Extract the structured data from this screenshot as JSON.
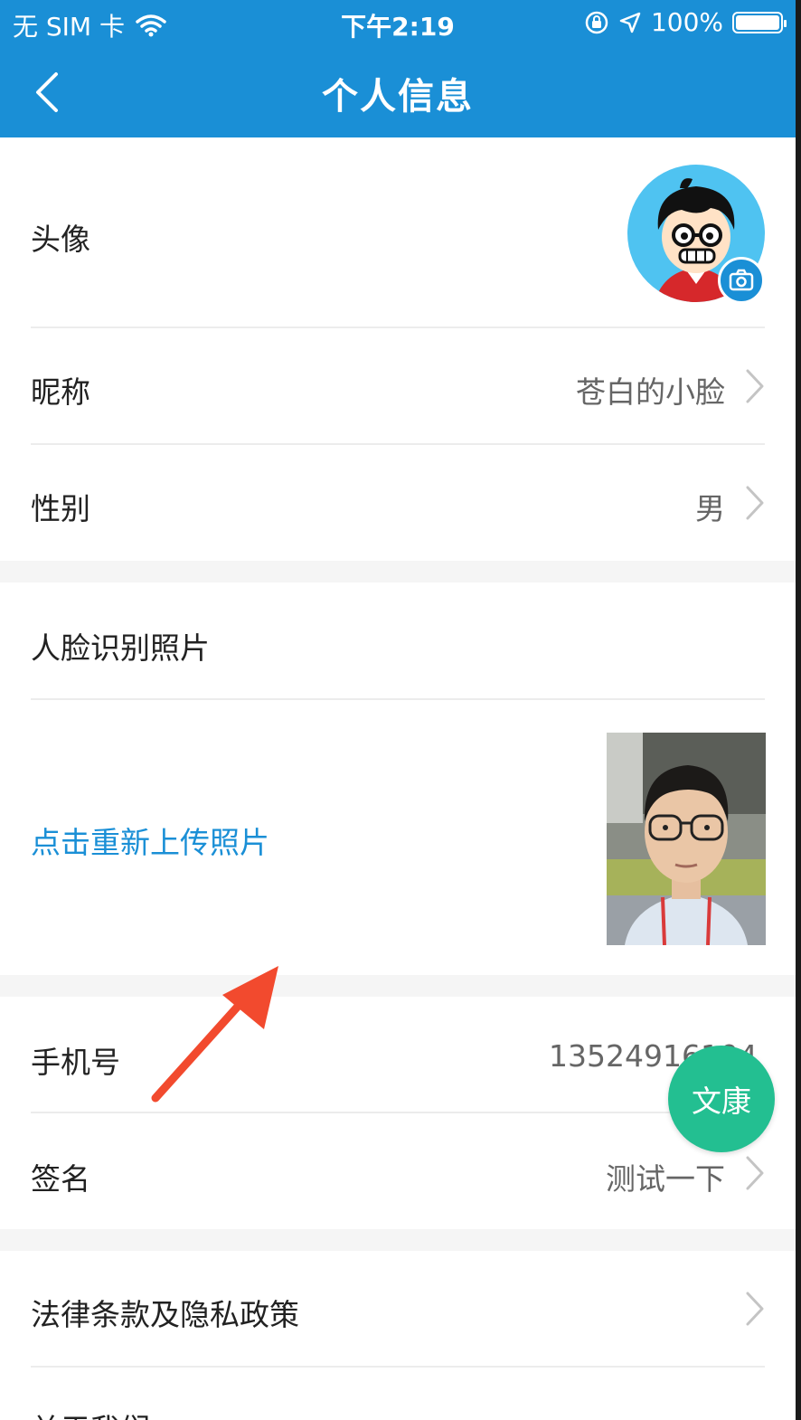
{
  "status_bar": {
    "carrier": "无 SIM 卡",
    "time": "下午2:19",
    "battery_text": "100%"
  },
  "nav": {
    "title": "个人信息"
  },
  "rows": {
    "avatar_label": "头像",
    "nickname_label": "昵称",
    "nickname_value": "苍白的小脸",
    "gender_label": "性别",
    "gender_value": "男",
    "face_label": "人脸识别照片",
    "upload_link": "点击重新上传照片",
    "phone_label": "手机号",
    "phone_value": "13524916104",
    "signature_label": "签名",
    "signature_value": "测试一下",
    "legal_label": "法律条款及隐私政策",
    "partial_label": "关于我们"
  },
  "fab": {
    "label": "文康"
  },
  "colors": {
    "brand": "#1a8fd6",
    "fab": "#23bf91",
    "annotation_arrow": "#f24a2e"
  }
}
